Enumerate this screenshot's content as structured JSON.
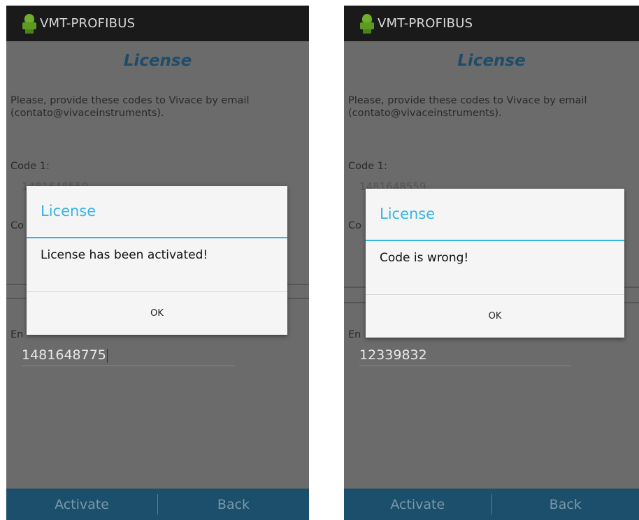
{
  "screens": [
    {
      "app_title": "VMT-PROFIBUS",
      "heading": "License",
      "instructions": "Please, provide these codes to Vivace by email (contato@vivaceinstruments).",
      "code1_label": "Code 1:",
      "code1_value": "1481648559",
      "code2_label_partial": "Co",
      "enter_label_partial": "En",
      "input_value": "1481648775",
      "activate_label": "Activate",
      "back_label": "Back",
      "dialog": {
        "title": "License",
        "message": "License has been activated!",
        "ok_label": "OK"
      }
    },
    {
      "app_title": "VMT-PROFIBUS",
      "heading": "License",
      "instructions": "Please, provide these codes to Vivace by email (contato@vivaceinstruments).",
      "code1_label": "Code 1:",
      "code1_value": "1481648559",
      "code2_label_partial": "Co",
      "enter_label_partial": "En",
      "input_value": "12339832",
      "activate_label": "Activate",
      "back_label": "Back",
      "dialog": {
        "title": "License",
        "message": "Code is wrong!",
        "ok_label": "OK"
      }
    }
  ],
  "colors": {
    "titlebar": "#1a1a1a",
    "screen_bg_dimmed": "#6b6b6b",
    "heading": "#1e4d6b",
    "dialog_accent": "#33b5e5",
    "bottom_bar": "#1c4f6c"
  }
}
